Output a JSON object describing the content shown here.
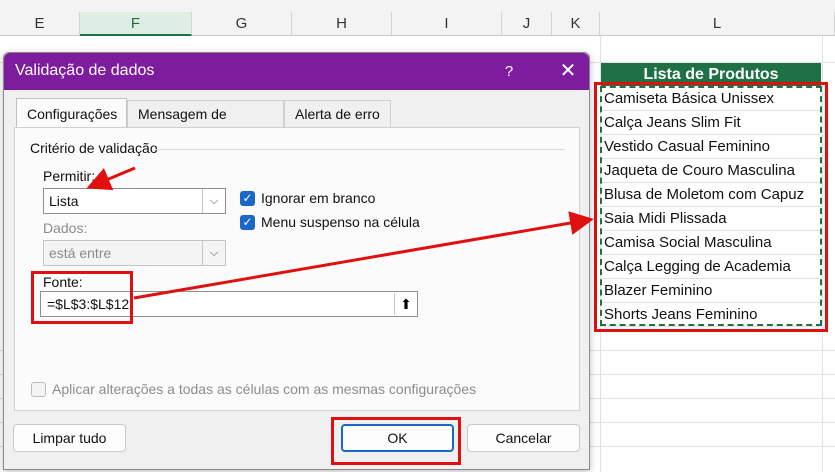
{
  "sheet": {
    "columns": [
      "E",
      "F",
      "G",
      "H",
      "I",
      "J",
      "K",
      "L"
    ],
    "list_header": "Lista de Produtos",
    "products": [
      "Camiseta Básica Unissex",
      "Calça Jeans Slim Fit",
      "Vestido Casual Feminino",
      "Jaqueta de Couro Masculina",
      "Blusa de Moletom com Capuz",
      "Saia Midi Plissada",
      "Camisa Social Masculina",
      "Calça Legging de Academia",
      "Blazer Feminino",
      "Shorts Jeans Feminino"
    ]
  },
  "dialog": {
    "title": "Validação de dados",
    "help": "?",
    "close": "✕",
    "tabs": [
      "Configurações",
      "Mensagem de entrada",
      "Alerta de erro"
    ],
    "group_title": "Critério de validação",
    "allow_label": "Permitir:",
    "allow_value": "Lista",
    "ignore_blank_label": "Ignorar em branco",
    "dropdown_label": "Menu suspenso na célula",
    "data_label": "Dados:",
    "data_value": "está entre",
    "source_label": "Fonte:",
    "source_value": "=$L$3:$L$12",
    "apply_all_label": "Aplicar alterações a todas as células com as mesmas configurações",
    "clear_all": "Limpar tudo",
    "ok": "OK",
    "cancel": "Cancelar"
  },
  "colors": {
    "titlebar": "#7e1c9e",
    "list_header_bg": "#1e7145",
    "highlight_red": "#e01010",
    "checkbox_blue": "#1a67c8"
  }
}
